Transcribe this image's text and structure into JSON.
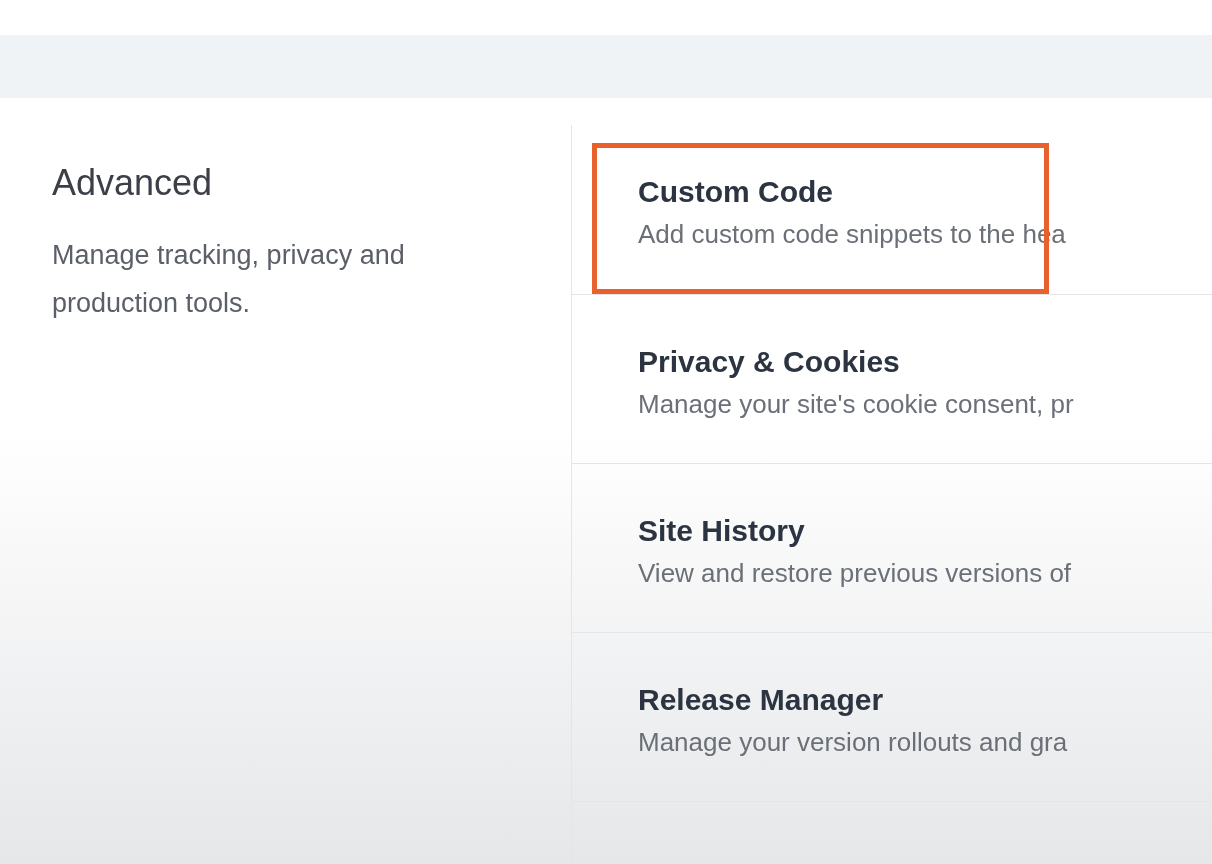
{
  "section": {
    "title": "Advanced",
    "description": "Manage tracking, privacy and production tools."
  },
  "items": [
    {
      "title": "Custom Code",
      "description": "Add custom code snippets to the hea",
      "highlighted": true
    },
    {
      "title": "Privacy & Cookies",
      "description": "Manage your site's cookie consent, pr",
      "highlighted": false
    },
    {
      "title": "Site History",
      "description": "View and restore previous versions of",
      "highlighted": false
    },
    {
      "title": "Release Manager",
      "description": "Manage your version rollouts and gra",
      "highlighted": false
    }
  ]
}
